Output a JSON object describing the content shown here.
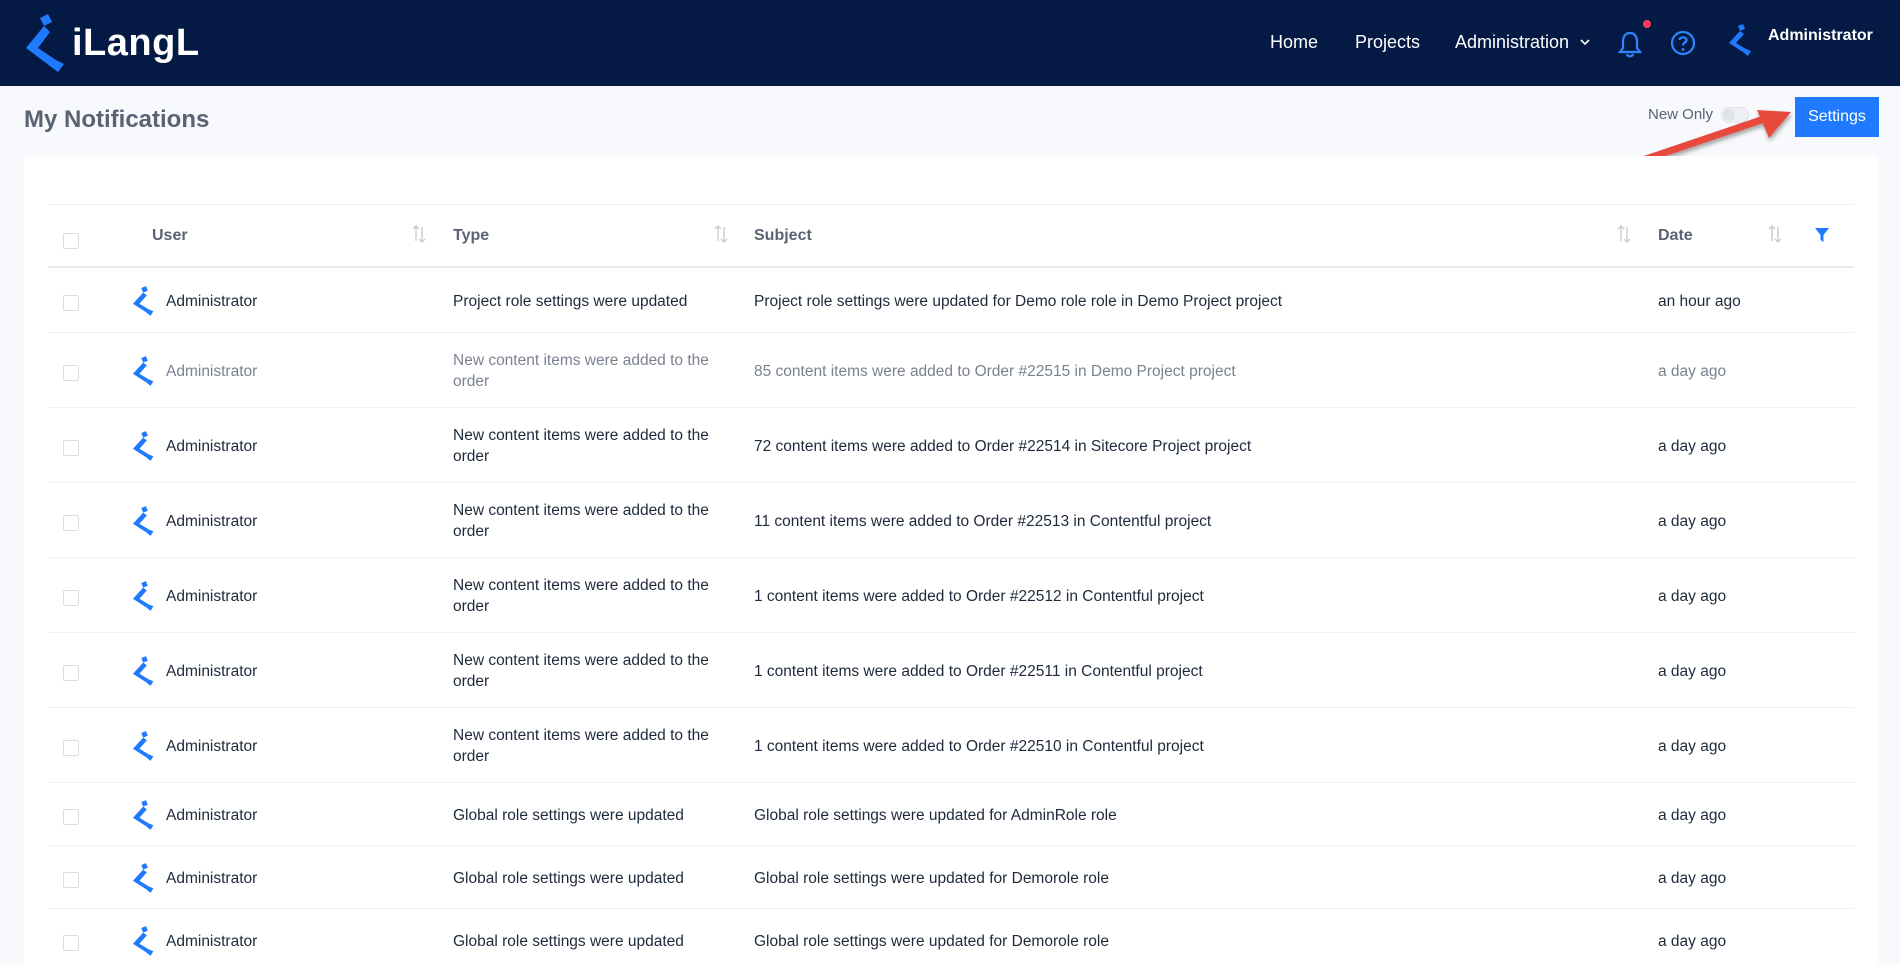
{
  "app": {
    "brand": "iLangL"
  },
  "nav": {
    "home": "Home",
    "projects": "Projects",
    "administration": "Administration",
    "user": "Administrator"
  },
  "page": {
    "title": "My Notifications",
    "new_only_label": "New Only",
    "new_only_enabled": false,
    "settings_button": "Settings"
  },
  "table": {
    "columns": {
      "user": "User",
      "type": "Type",
      "subject": "Subject",
      "date": "Date"
    },
    "rows": [
      {
        "user": "Administrator",
        "type": "Project role settings were updated",
        "subject": "Project role settings were updated for Demo role role in Demo Project project",
        "date": "an hour ago",
        "read": false
      },
      {
        "user": "Administrator",
        "type": "New content items were added to the order",
        "subject": "85 content items were added to Order #22515 in Demo Project project",
        "date": "a day ago",
        "read": true
      },
      {
        "user": "Administrator",
        "type": "New content items were added to the order",
        "subject": "72 content items were added to Order #22514 in Sitecore Project project",
        "date": "a day ago",
        "read": false
      },
      {
        "user": "Administrator",
        "type": "New content items were added to the order",
        "subject": "11 content items were added to Order #22513 in Contentful project",
        "date": "a day ago",
        "read": false
      },
      {
        "user": "Administrator",
        "type": "New content items were added to the order",
        "subject": "1 content items were added to Order #22512 in Contentful project",
        "date": "a day ago",
        "read": false
      },
      {
        "user": "Administrator",
        "type": "New content items were added to the order",
        "subject": "1 content items were added to Order #22511 in Contentful project",
        "date": "a day ago",
        "read": false
      },
      {
        "user": "Administrator",
        "type": "New content items were added to the order",
        "subject": "1 content items were added to Order #22510 in Contentful project",
        "date": "a day ago",
        "read": false
      },
      {
        "user": "Administrator",
        "type": "Global role settings were updated",
        "subject": "Global role settings were updated for AdminRole role",
        "date": "a day ago",
        "read": false
      },
      {
        "user": "Administrator",
        "type": "Global role settings were updated",
        "subject": "Global role settings were updated for Demorole role",
        "date": "a day ago",
        "read": false
      },
      {
        "user": "Administrator",
        "type": "Global role settings were updated",
        "subject": "Global role settings were updated for Demorole role",
        "date": "a day ago",
        "read": false
      }
    ]
  },
  "colors": {
    "nav_bg": "#041a45",
    "accent": "#1f7aff",
    "annotation_arrow": "#e8493d"
  }
}
